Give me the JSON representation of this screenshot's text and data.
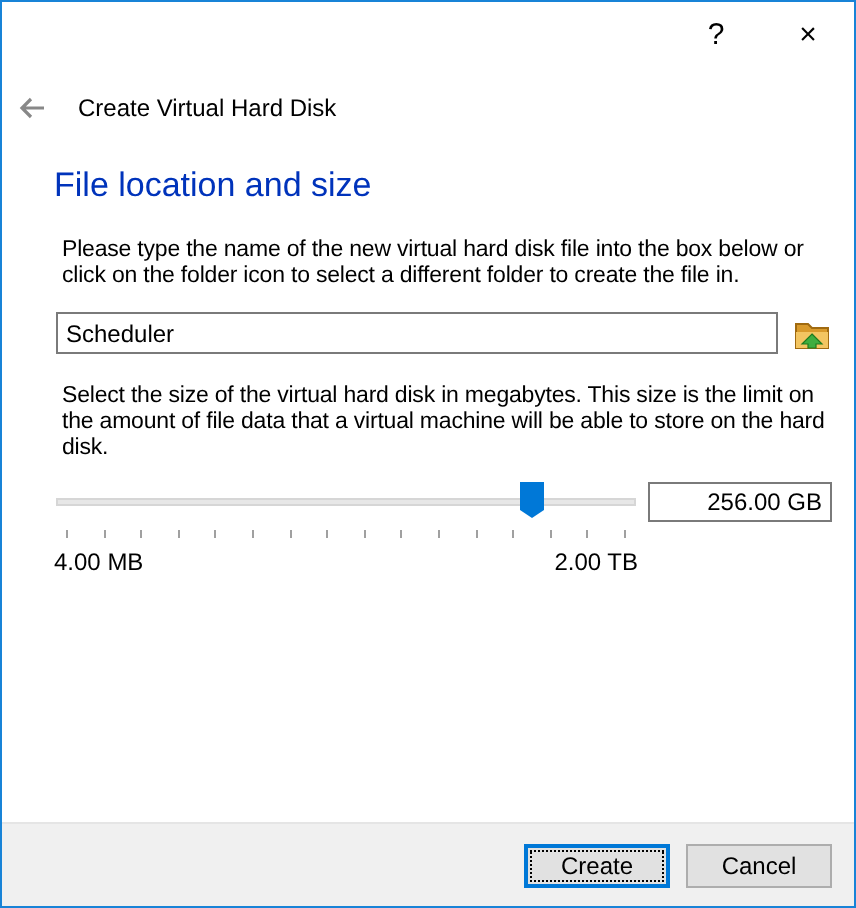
{
  "window": {
    "help": "?",
    "close": "×"
  },
  "header": {
    "title": "Create Virtual Hard Disk"
  },
  "page": {
    "heading": "File location and size",
    "location_text": "Please type the name of the new virtual hard disk file into the box below or click on the folder icon to select a different folder to create the file in.",
    "file_name": "Scheduler",
    "size_text": "Select the size of the virtual hard disk in megabytes. This size is the limit on the amount of file data that a virtual machine will be able to store on the hard disk.",
    "size_slider": {
      "level": 0.82,
      "min_label": "4.00 MB",
      "max_label": "2.00 TB"
    },
    "size_value": "256.00 GB"
  },
  "buttons": [
    {
      "label": "Create",
      "default": true
    },
    {
      "label": "Cancel",
      "default": false
    }
  ]
}
